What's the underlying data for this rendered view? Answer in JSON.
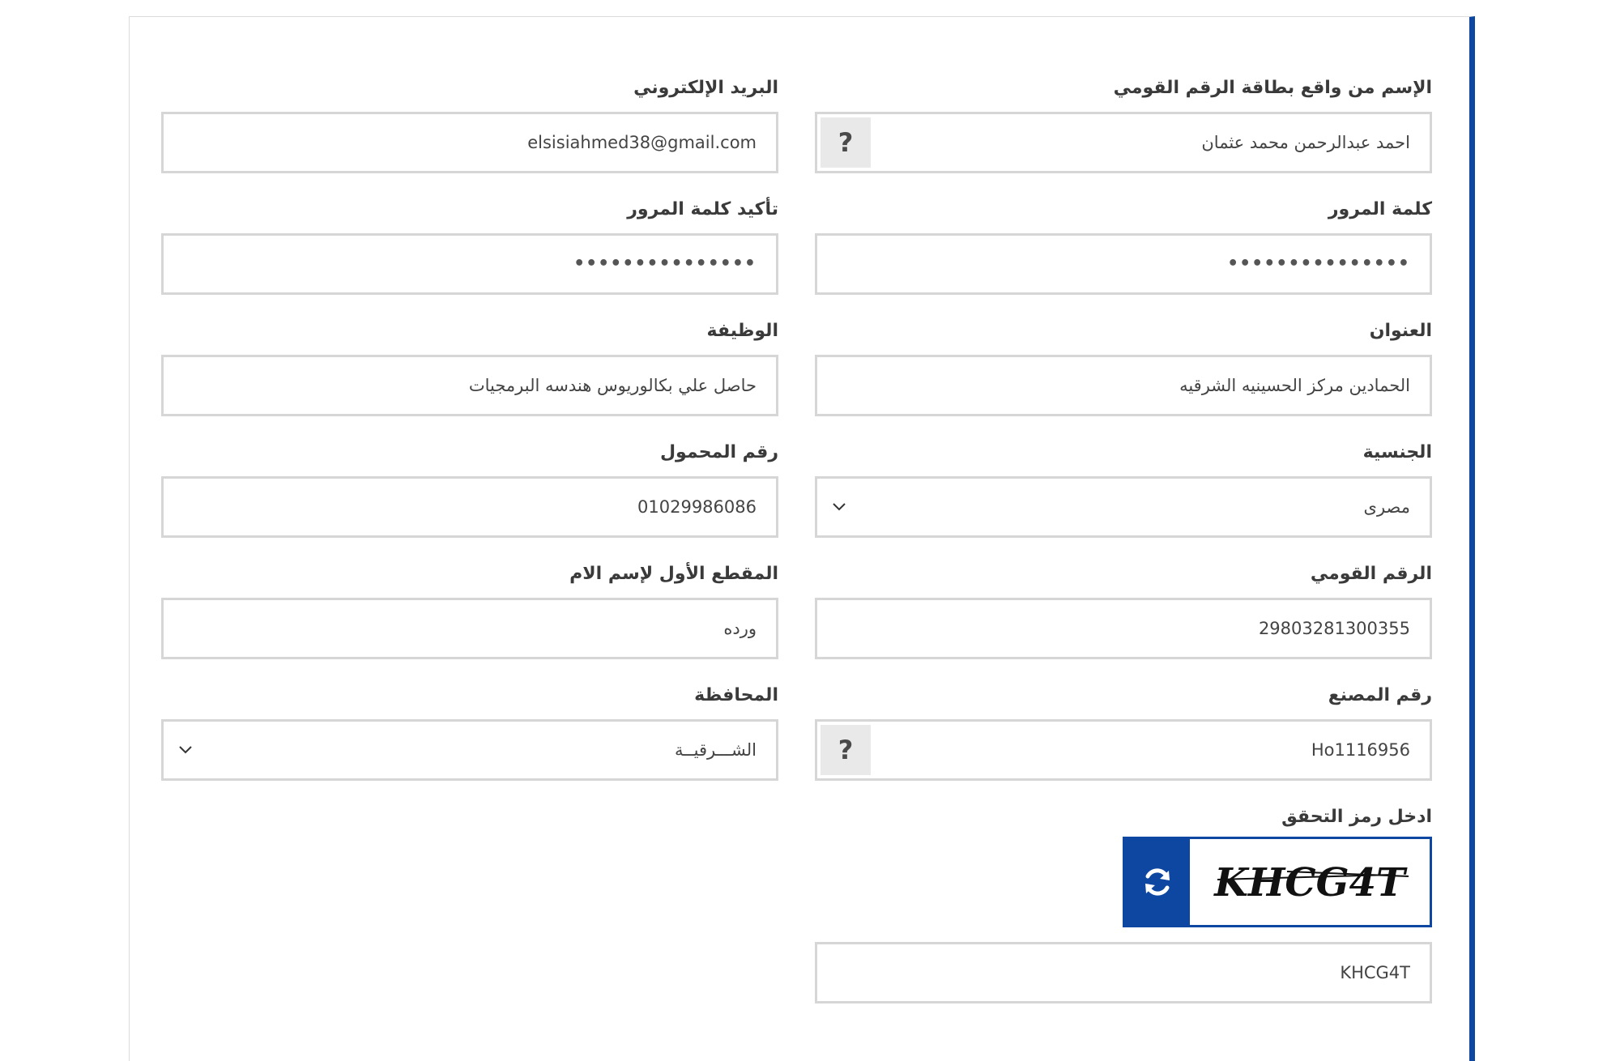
{
  "form": {
    "full_name": {
      "label": "الإسم من واقع بطاقة الرقم القومي",
      "value": "احمد عبدالرحمن محمد عثمان",
      "help": "?"
    },
    "email": {
      "label": "البريد الإلكتروني",
      "value": "elsisiahmed38@gmail.com"
    },
    "password": {
      "label": "كلمة المرور",
      "value": "•••••••••••••••"
    },
    "confirm_password": {
      "label": "تأكيد كلمة المرور",
      "value": "•••••••••••••••"
    },
    "address": {
      "label": "العنوان",
      "value": "الحمادين مركز الحسينيه الشرقيه"
    },
    "job": {
      "label": "الوظيفة",
      "value": "حاصل علي بكالوريوس هندسه البرمجيات"
    },
    "nationality": {
      "label": "الجنسية",
      "value": "مصرى"
    },
    "mobile": {
      "label": "رقم المحمول",
      "value": "01029986086"
    },
    "national_id": {
      "label": "الرقم القومي",
      "value": "29803281300355"
    },
    "mother_name": {
      "label": "المقطع الأول لإسم الام",
      "value": "ورده"
    },
    "factory_number": {
      "label": "رقم المصنع",
      "value": "Ho1116956",
      "help": "?"
    },
    "governorate": {
      "label": "المحافظة",
      "value": "الشـــرقيــة"
    },
    "captcha": {
      "label": "ادخل رمز التحقق",
      "image_text": "KHCG4T",
      "value": "KHCG4T"
    }
  },
  "colors": {
    "accent": "#0d47a1",
    "border": "#d6d6d6",
    "text": "#3a3a3a"
  }
}
